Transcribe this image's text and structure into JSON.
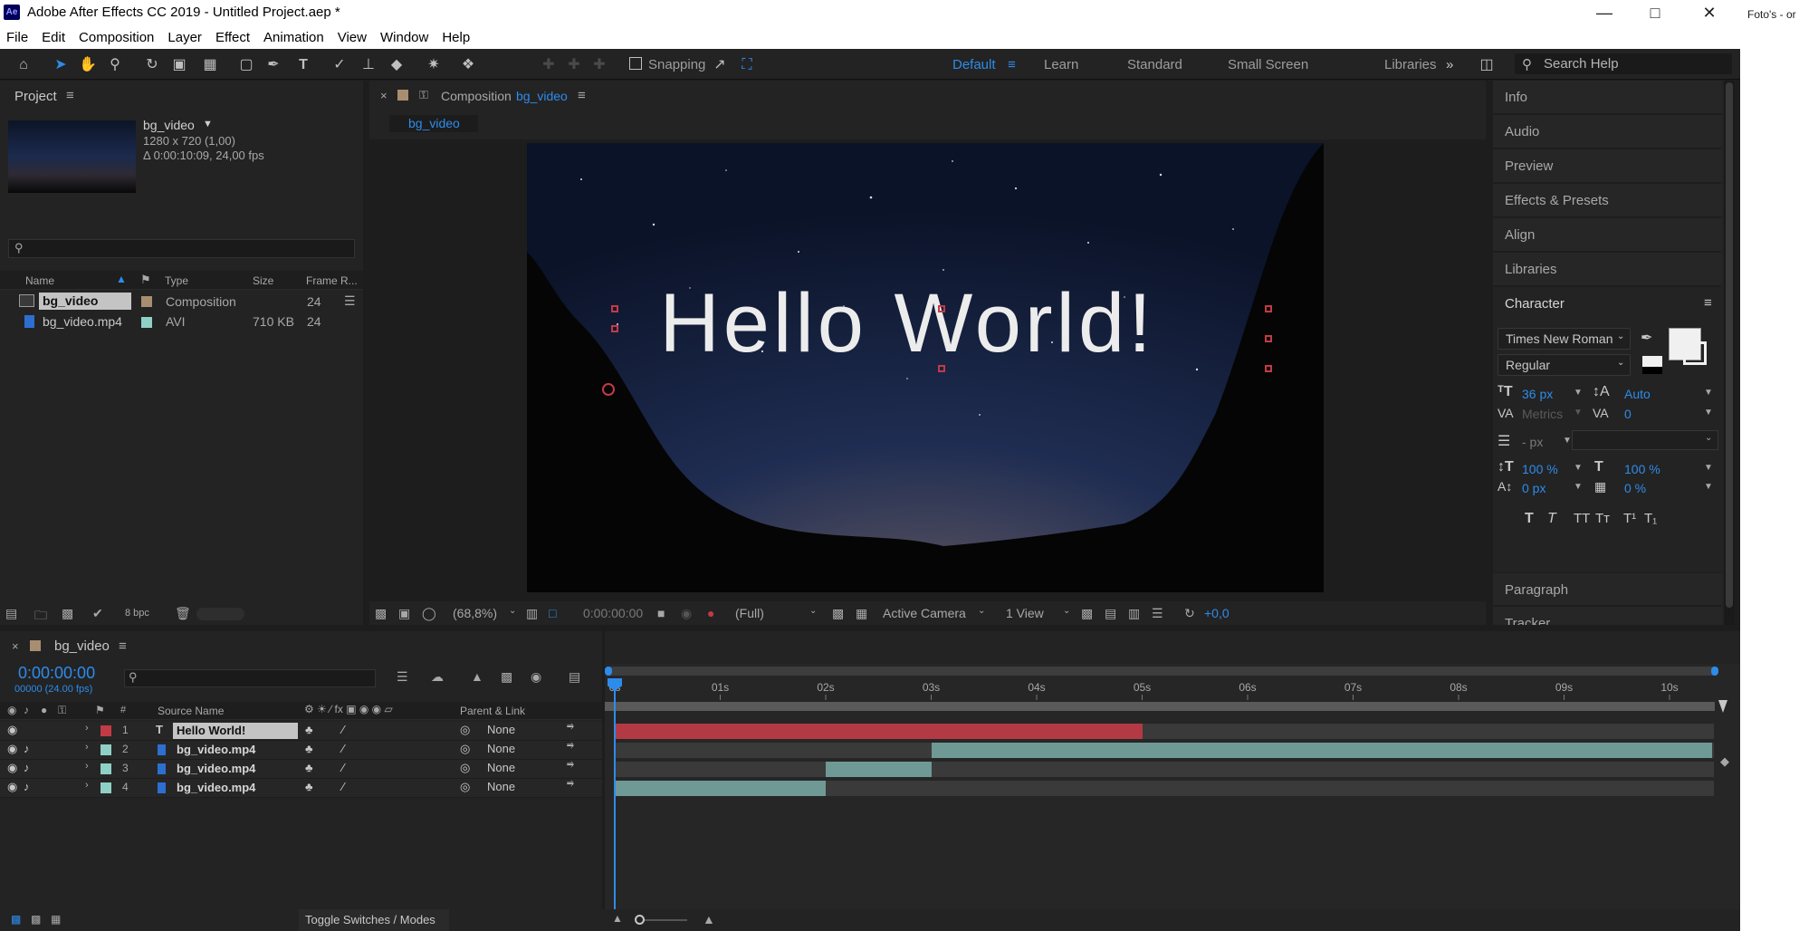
{
  "window": {
    "title": "Adobe After Effects CC 2019 - Untitled Project.aep *",
    "logo": "Ae",
    "side_fragment": "Foto's - or"
  },
  "menu": [
    "File",
    "Edit",
    "Composition",
    "Layer",
    "Effect",
    "Animation",
    "View",
    "Window",
    "Help"
  ],
  "toolbar": {
    "snapping": "Snapping",
    "workspaces": [
      "Default",
      "Learn",
      "Standard",
      "Small Screen",
      "Libraries"
    ],
    "search_placeholder": "Search Help"
  },
  "project": {
    "title": "Project",
    "item": {
      "name": "bg_video",
      "size": "1280 x 720 (1,00)",
      "duration": "Δ 0:00:10:09, 24,00 fps"
    },
    "columns": [
      "Name",
      "Type",
      "Size",
      "Frame R..."
    ],
    "rows": [
      {
        "name": "bg_video",
        "type": "Composition",
        "size": "",
        "fps": "24"
      },
      {
        "name": "bg_video.mp4",
        "type": "AVI",
        "size": "710 KB",
        "fps": "24"
      }
    ],
    "bpc": "8 bpc"
  },
  "composition": {
    "panel_prefix": "Composition",
    "name": "bg_video",
    "tab": "bg_video",
    "text_overlay": "Hello World!",
    "footer": {
      "zoom": "(68,8%)",
      "time": "0:00:00:00",
      "resolution": "(Full)",
      "camera": "Active Camera",
      "views": "1 View",
      "exposure": "+0,0"
    }
  },
  "right_panels": [
    "Info",
    "Audio",
    "Preview",
    "Effects & Presets",
    "Align",
    "Libraries"
  ],
  "character": {
    "title": "Character",
    "font": "Times New Roman",
    "style": "Regular",
    "size": "36 px",
    "leading": "Auto",
    "kerning": "Metrics",
    "tracking": "0",
    "stroke": "- px",
    "vscale": "100 %",
    "hscale": "100 %",
    "baseline": "0 px",
    "tsume": "0 %",
    "style_buttons": [
      "T",
      "T",
      "TT",
      "Tт",
      "T¹",
      "T₁"
    ],
    "next_panels": [
      "Paragraph",
      "Tracker"
    ]
  },
  "timeline": {
    "tab": "bg_video",
    "timecode": "0:00:00:00",
    "frames": "00000 (24.00 fps)",
    "columns": {
      "num": "#",
      "source": "Source Name",
      "parent": "Parent & Link"
    },
    "ruler": [
      "0s",
      "01s",
      "02s",
      "03s",
      "04s",
      "05s",
      "06s",
      "07s",
      "08s",
      "09s",
      "10s"
    ],
    "duration_seconds": 10.4,
    "layers": [
      {
        "num": "1",
        "name": "Hello World!",
        "type": "text",
        "color": "#c33a45",
        "parent": "None",
        "bar_start": 0,
        "bar_end": 5.0
      },
      {
        "num": "2",
        "name": "bg_video.mp4",
        "type": "footage",
        "color": "#8fd0c6",
        "parent": "None",
        "bar_start": 3.0,
        "bar_end": 10.4
      },
      {
        "num": "3",
        "name": "bg_video.mp4",
        "type": "footage",
        "color": "#8fd0c6",
        "parent": "None",
        "bar_start": 2.0,
        "bar_end": 3.0
      },
      {
        "num": "4",
        "name": "bg_video.mp4",
        "type": "footage",
        "color": "#8fd0c6",
        "parent": "None",
        "bar_start": 0,
        "bar_end": 2.0
      }
    ],
    "toggle_label": "Toggle Switches / Modes"
  },
  "colors": {
    "accent": "#2d8ceb",
    "text_layer": "#c33a45",
    "footage": "#8fd0c6",
    "panel": "#232323"
  }
}
